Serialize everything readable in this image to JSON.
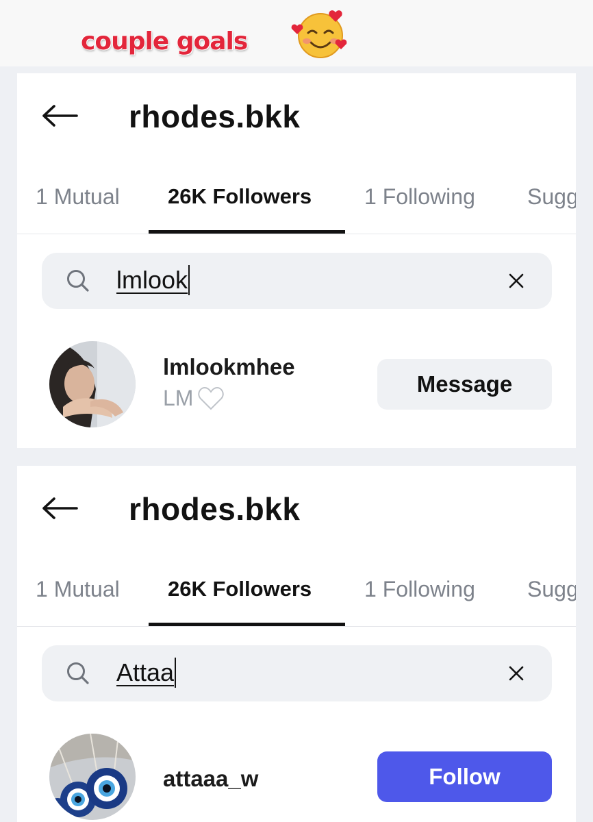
{
  "caption": {
    "text": "couple goals",
    "emoji": "smiling-face-with-hearts-emoji"
  },
  "panels": [
    {
      "title": "rhodes.bkk",
      "tabs": [
        {
          "label": "1 Mutual"
        },
        {
          "label": "26K Followers",
          "active": true
        },
        {
          "label": "1 Following"
        },
        {
          "label": "Sugg"
        }
      ],
      "search": {
        "value": "lmlook"
      },
      "result": {
        "username": "lmlookmhee",
        "display_name": "LM",
        "action": "Message"
      }
    },
    {
      "title": "rhodes.bkk",
      "tabs": [
        {
          "label": "1 Mutual"
        },
        {
          "label": "26K Followers",
          "active": true
        },
        {
          "label": "1 Following"
        },
        {
          "label": "Sugg"
        }
      ],
      "search": {
        "value": "Attaa"
      },
      "result": {
        "username": "attaaa_w",
        "display_name": "",
        "action": "Follow"
      }
    }
  ],
  "colors": {
    "caption": "#e3263b",
    "follow_button": "#4e58ea",
    "search_background": "#eff1f4",
    "muted_text": "#7d828b"
  }
}
